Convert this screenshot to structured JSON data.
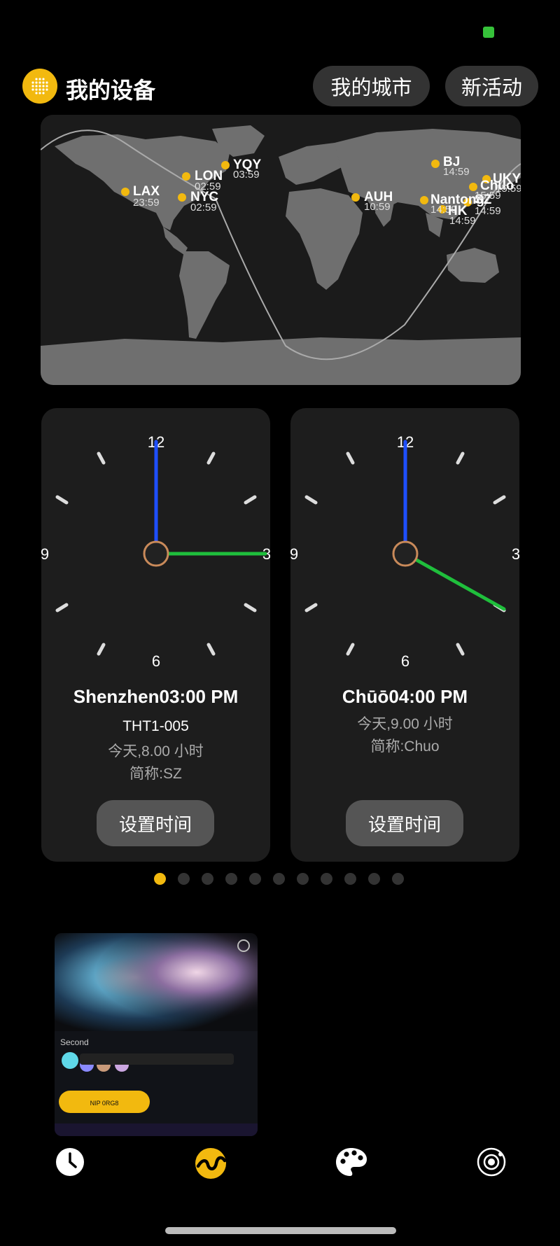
{
  "header": {
    "title": "我的设备",
    "btn_city": "我的城市",
    "btn_activity": "新活动"
  },
  "map": {
    "cities": [
      {
        "code": "LAX",
        "time": "23:59"
      },
      {
        "code": "LON",
        "time": "02:59"
      },
      {
        "code": "NYC",
        "time": "02:59"
      },
      {
        "code": "YQY",
        "time": "03:59"
      },
      {
        "code": "AUH",
        "time": "10:59"
      },
      {
        "code": "BJ",
        "time": "14:59"
      },
      {
        "code": "Nantong",
        "time": "14:59"
      },
      {
        "code": "HK",
        "time": "14:59"
      },
      {
        "code": "SZ",
        "time": "14:59"
      },
      {
        "code": "Chuo",
        "time": "15:59"
      },
      {
        "code": "UKY",
        "time": "15:59"
      }
    ]
  },
  "cards": [
    {
      "city_time": "Shenzhen03:00 PM",
      "device": "THT1-005",
      "offset": "今天,8.00 小时",
      "abbr": "简称:SZ",
      "button": "设置时间",
      "dial": {
        "n12": "12",
        "n3": "3",
        "n6": "6",
        "n9": "9"
      },
      "hour": 3
    },
    {
      "city_time": "Chūō04:00 PM",
      "offset": "今天,9.00 小时",
      "abbr": "简称:Chuo",
      "button": "设置时间",
      "dial": {
        "n12": "12",
        "n3": "3",
        "n6": "6",
        "n9": "9"
      },
      "hour": 4
    }
  ],
  "pager": {
    "count": 11,
    "active": 0
  },
  "preview": {
    "section_label": "Second",
    "button_label": "NIP 0RG8"
  },
  "nav": {
    "items": [
      "clock-icon",
      "activity-icon",
      "palette-icon",
      "orbit-icon"
    ],
    "active": 1
  },
  "colors": {
    "accent": "#f2b90f",
    "hour_hand": "#1e4fff",
    "minute_hand": "#1fbf3c"
  }
}
